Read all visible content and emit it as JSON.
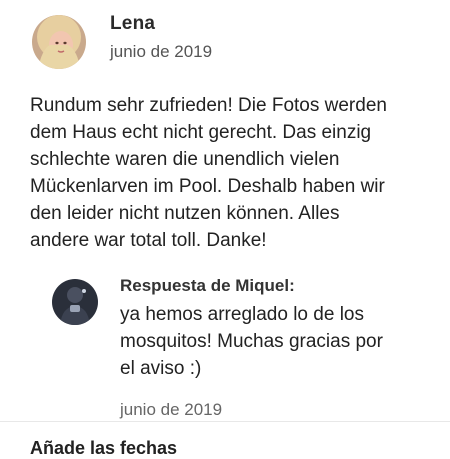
{
  "review": {
    "reviewer_name": "Lena",
    "date": "junio de 2019",
    "text_lines": [
      "Rundum sehr zufrieden! Die Fotos werden",
      "dem Haus echt nicht gerecht. Das einzig",
      "schlechte waren die unendlich vielen",
      "Mückenlarven im Pool. Deshalb haben wir",
      "den leider nicht nutzen können. Alles",
      "andere war total toll. Danke!"
    ]
  },
  "response": {
    "title": "Respuesta de Miquel:",
    "text_lines": [
      "ya hemos arreglado lo de los",
      "mosquitos! Muchas gracias por",
      "el aviso :)"
    ],
    "date": "junio de 2019"
  },
  "next_section": {
    "label": "Añade las fechas"
  },
  "colors": {
    "text_primary": "#222222",
    "text_secondary": "#555555"
  }
}
